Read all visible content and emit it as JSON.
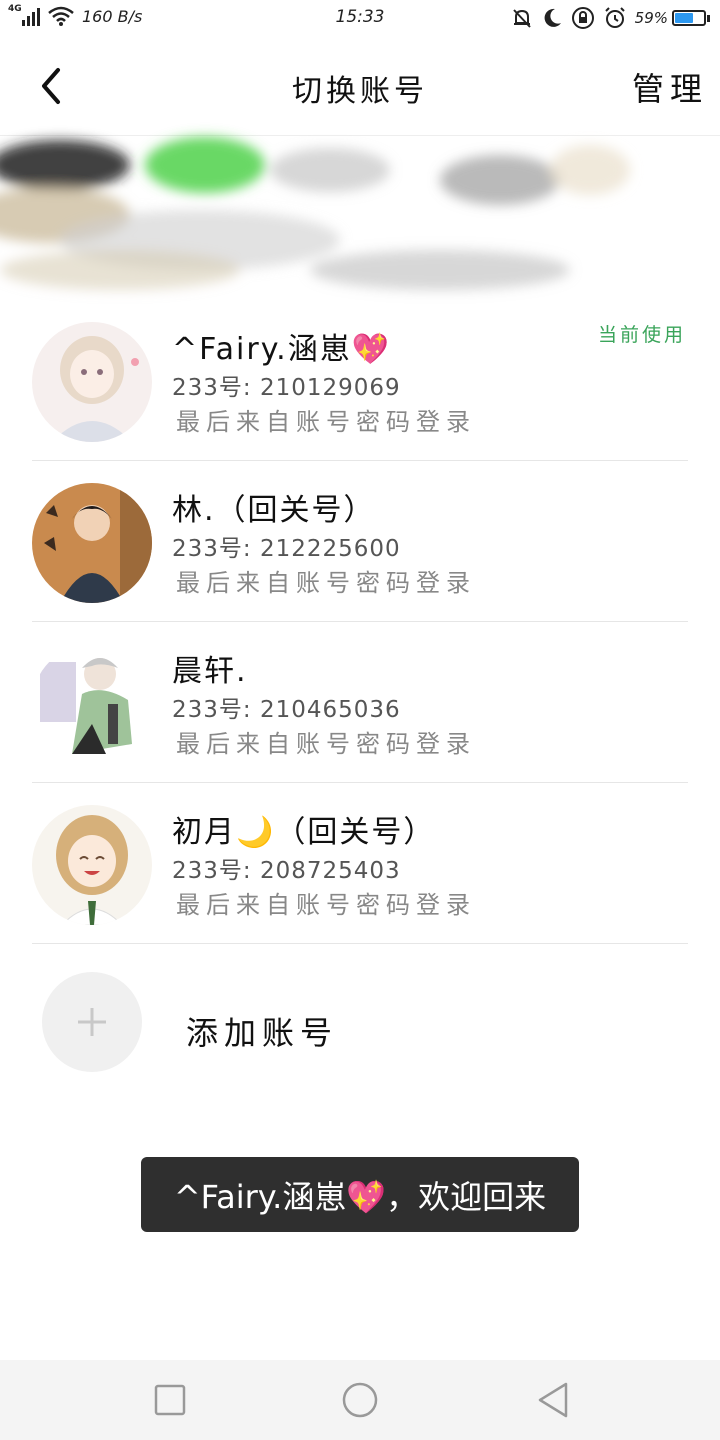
{
  "status_bar": {
    "network": "4G",
    "speed": "160 B/s",
    "time": "15:33",
    "battery": "59%",
    "battery_level": 0.59
  },
  "header": {
    "title": "切换账号",
    "manage_label": "管理"
  },
  "accounts": [
    {
      "name": "^Fairy.涵崽💖",
      "uid": "233号: 210129069",
      "last_login": "最后来自账号密码登录",
      "current_label": "当前使用"
    },
    {
      "name": "林.（回关号）",
      "uid": "233号: 212225600",
      "last_login": "最后来自账号密码登录"
    },
    {
      "name": "晨轩.",
      "uid": "233号: 210465036",
      "last_login": "最后来自账号密码登录"
    },
    {
      "name": "初月🌙（回关号）",
      "uid": "233号: 208725403",
      "last_login": "最后来自账号密码登录"
    }
  ],
  "add_account": {
    "label": "添加账号"
  },
  "toast": {
    "text": "^Fairy.涵崽💖，欢迎回来"
  },
  "colors": {
    "current_green": "#3aa45a",
    "toast_bg": "#2f2f2f",
    "battery_blue": "#2c98f0"
  },
  "icons": [
    "back-arrow-icon",
    "plus-icon",
    "nav-recents-icon",
    "nav-home-icon",
    "nav-back-icon",
    "mute-bell-icon",
    "moon-icon",
    "lock-rotation-icon",
    "alarm-icon",
    "wifi-icon",
    "signal-icon"
  ]
}
